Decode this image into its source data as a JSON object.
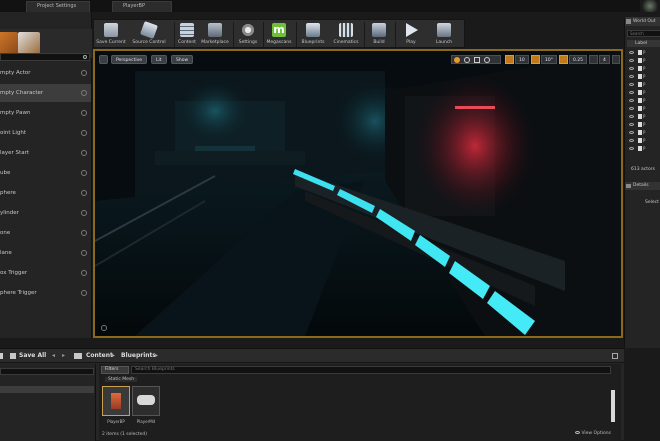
{
  "tabs": [
    {
      "label": "Project Settings"
    },
    {
      "label": "PlayerBP"
    }
  ],
  "place_panel": {
    "items": [
      {
        "label": "mpty Actor"
      },
      {
        "label": "mpty Character"
      },
      {
        "label": "mpty Pawn"
      },
      {
        "label": "oint Light"
      },
      {
        "label": "layer Start"
      },
      {
        "label": "ube"
      },
      {
        "label": "phere"
      },
      {
        "label": "ylinder"
      },
      {
        "label": "one"
      },
      {
        "label": "lane"
      },
      {
        "label": "ox Trigger"
      },
      {
        "label": "phere Trigger"
      }
    ],
    "selected_index": 1
  },
  "toolbar": {
    "buttons": [
      {
        "label": "Save Current",
        "icon": "save-icon"
      },
      {
        "label": "Source Control",
        "icon": "source-control-icon"
      },
      {
        "label": "Content",
        "icon": "content-icon"
      },
      {
        "label": "Marketplace",
        "icon": "marketplace-icon"
      },
      {
        "label": "Settings",
        "icon": "settings-icon"
      },
      {
        "label": "Megascans",
        "icon": "megascans-icon"
      },
      {
        "label": "Blueprints",
        "icon": "blueprints-icon"
      },
      {
        "label": "Cinematics",
        "icon": "cinematics-icon"
      },
      {
        "label": "Build",
        "icon": "build-icon"
      },
      {
        "label": "Play",
        "icon": "play-icon"
      },
      {
        "label": "Launch",
        "icon": "launch-icon"
      }
    ]
  },
  "viewport": {
    "perspective_label": "Perspective",
    "lit_label": "Lit",
    "show_label": "Show",
    "grid_snap": "10",
    "rotation_snap": "10°",
    "scale_snap": "0.25",
    "camera_speed": "4"
  },
  "outliner": {
    "title": "World Out",
    "search_placeholder": "Search",
    "column_label": "Label",
    "rows": [
      "P",
      "P",
      "P",
      "P",
      "P",
      "P",
      "P",
      "P",
      "P",
      "P",
      "P",
      "P",
      "P"
    ],
    "actor_count": "613 actors"
  },
  "details": {
    "title": "Details",
    "select_text": "Select"
  },
  "content_browser": {
    "save_all_label": "Save All",
    "path": [
      "Content",
      "Blueprints"
    ],
    "filters_label": "Filters",
    "search_placeholder": "Search Blueprints",
    "static_mesh_label": "Static Mesh",
    "assets": [
      {
        "name": "PlayerBP"
      },
      {
        "name": "PlayerMd"
      }
    ],
    "status": "2 items (1 selected)",
    "view_options": "View Options"
  }
}
